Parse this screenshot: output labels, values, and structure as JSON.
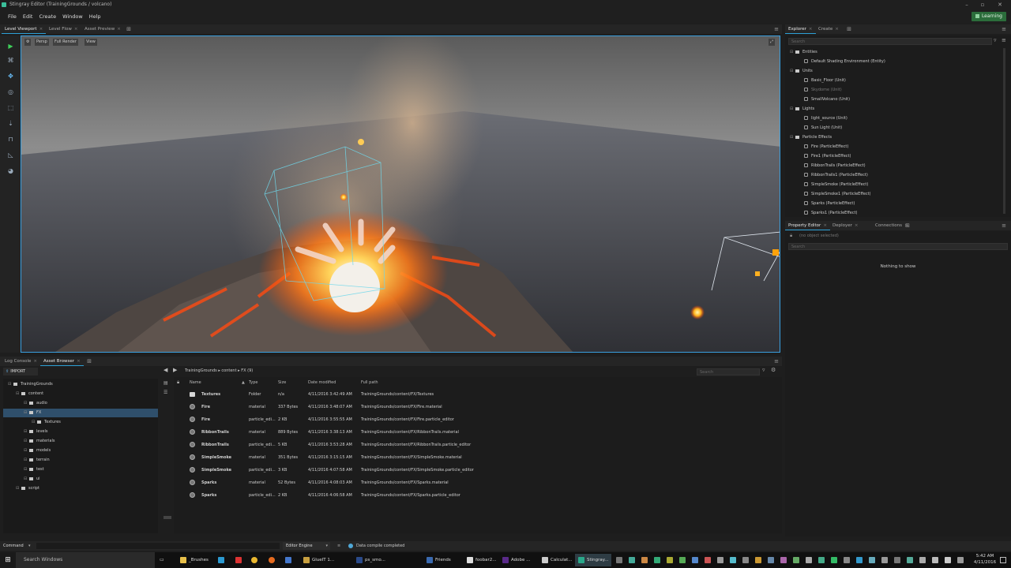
{
  "window": {
    "title": "Stingray Editor (TrainingGrounds / volcano)"
  },
  "menu": [
    "File",
    "Edit",
    "Create",
    "Window",
    "Help"
  ],
  "learning_button": "Learning",
  "viewport_tabs": [
    {
      "label": "Level Viewport",
      "active": true
    },
    {
      "label": "Level Flow",
      "active": false
    },
    {
      "label": "Asset Preview",
      "active": false
    }
  ],
  "viewport": {
    "persp": "Persp",
    "render": "Full Render",
    "view": "View"
  },
  "explorer": {
    "tabs": [
      "Explorer",
      "Create"
    ],
    "search_placeholder": "Search",
    "groups": [
      {
        "label": "Entities",
        "items": [
          {
            "label": "Default Shading Environment (Entity)",
            "dim": false
          }
        ]
      },
      {
        "label": "Units",
        "items": [
          {
            "label": "Basic_Floor (Unit)",
            "dim": false
          },
          {
            "label": "Skydome (Unit)",
            "dim": true
          },
          {
            "label": "SmallVolcano (Unit)",
            "dim": false
          }
        ]
      },
      {
        "label": "Lights",
        "items": [
          {
            "label": "light_source (Unit)",
            "dim": false
          },
          {
            "label": "Sun Light (Unit)",
            "dim": false
          }
        ]
      },
      {
        "label": "Particle Effects",
        "items": [
          {
            "label": "Fire (ParticleEffect)",
            "dim": false
          },
          {
            "label": "Fire1 (ParticleEffect)",
            "dim": false
          },
          {
            "label": "RibbonTrails (ParticleEffect)",
            "dim": false
          },
          {
            "label": "RibbonTrails1 (ParticleEffect)",
            "dim": false
          },
          {
            "label": "SimpleSmoke (ParticleEffect)",
            "dim": false
          },
          {
            "label": "SimpleSmoke1 (ParticleEffect)",
            "dim": false
          },
          {
            "label": "Sparks (ParticleEffect)",
            "dim": false
          },
          {
            "label": "Sparks1 (ParticleEffect)",
            "dim": false
          }
        ]
      }
    ]
  },
  "property": {
    "tabs": [
      "Property Editor",
      "Deployer",
      "Connections"
    ],
    "selection": "(no object selected)",
    "search_placeholder": "Search",
    "empty": "Nothing to show"
  },
  "bottom_tabs": [
    {
      "label": "Log Console",
      "active": false
    },
    {
      "label": "Asset Browser",
      "active": true
    }
  ],
  "asset_browser": {
    "import": "IMPORT",
    "breadcrumb": "TrainingGrounds ▸ content ▸ FX (9)",
    "search_placeholder": "Search",
    "tree": [
      {
        "label": "TrainingGrounds",
        "depth": 0,
        "sel": false
      },
      {
        "label": "content",
        "depth": 1,
        "sel": false
      },
      {
        "label": "audio",
        "depth": 2,
        "sel": false
      },
      {
        "label": "FX",
        "depth": 2,
        "sel": true
      },
      {
        "label": "Textures",
        "depth": 3,
        "sel": false
      },
      {
        "label": "levels",
        "depth": 2,
        "sel": false
      },
      {
        "label": "materials",
        "depth": 2,
        "sel": false
      },
      {
        "label": "models",
        "depth": 2,
        "sel": false
      },
      {
        "label": "terrain",
        "depth": 2,
        "sel": false
      },
      {
        "label": "test",
        "depth": 2,
        "sel": false
      },
      {
        "label": "ui",
        "depth": 2,
        "sel": false
      },
      {
        "label": "script",
        "depth": 1,
        "sel": false
      }
    ],
    "columns": {
      "name": "Name",
      "type": "Type",
      "size": "Size",
      "modified": "Date modified",
      "path": "Full path"
    },
    "rows": [
      {
        "icon": "folder",
        "name": "Textures",
        "type": "Folder",
        "size": "n/a",
        "modified": "4/11/2016 3:42:49 AM",
        "path": "TrainingGrounds/content/FX/Textures"
      },
      {
        "icon": "material",
        "name": "Fire",
        "type": "material",
        "size": "337 Bytes",
        "modified": "4/11/2016 3:48:07 AM",
        "path": "TrainingGrounds/content/FX/Fire.material"
      },
      {
        "icon": "particle",
        "name": "Fire",
        "type": "particle_edi...",
        "size": "2 KB",
        "modified": "4/11/2016 3:55:55 AM",
        "path": "TrainingGrounds/content/FX/Fire.particle_editor"
      },
      {
        "icon": "material",
        "name": "RibbonTrails",
        "type": "material",
        "size": "889 Bytes",
        "modified": "4/11/2016 3:38:13 AM",
        "path": "TrainingGrounds/content/FX/RibbonTrails.material"
      },
      {
        "icon": "particle",
        "name": "RibbonTrails",
        "type": "particle_edi...",
        "size": "5 KB",
        "modified": "4/11/2016 3:53:28 AM",
        "path": "TrainingGrounds/content/FX/RibbonTrails.particle_editor"
      },
      {
        "icon": "material",
        "name": "SimpleSmoke",
        "type": "material",
        "size": "351 Bytes",
        "modified": "4/11/2016 3:15:15 AM",
        "path": "TrainingGrounds/content/FX/SimpleSmoke.material"
      },
      {
        "icon": "particle",
        "name": "SimpleSmoke",
        "type": "particle_edi...",
        "size": "3 KB",
        "modified": "4/11/2016 4:07:58 AM",
        "path": "TrainingGrounds/content/FX/SimpleSmoke.particle_editor"
      },
      {
        "icon": "material",
        "name": "Sparks",
        "type": "material",
        "size": "52 Bytes",
        "modified": "4/11/2016 4:08:03 AM",
        "path": "TrainingGrounds/content/FX/Sparks.material"
      },
      {
        "icon": "particle",
        "name": "Sparks",
        "type": "particle_edi...",
        "size": "2 KB",
        "modified": "4/11/2016 4:06:58 AM",
        "path": "TrainingGrounds/content/FX/Sparks.particle_editor"
      }
    ]
  },
  "command": {
    "label": "Command",
    "engine": "Editor Engine",
    "status": "Data compile completed"
  },
  "taskbar": {
    "search": "Search Windows",
    "apps": [
      "_Brushes",
      "GlueIT 1...",
      "ps_smo...",
      "Friends",
      "foobar2...",
      "Adobe ...",
      "Calculat...",
      "Stingray..."
    ],
    "time": "5:42 AM",
    "date": "4/11/2016"
  },
  "colors": {
    "accent": "#2da0d6",
    "learning": "#2b6d3b",
    "selection": "#2f4f6b"
  }
}
